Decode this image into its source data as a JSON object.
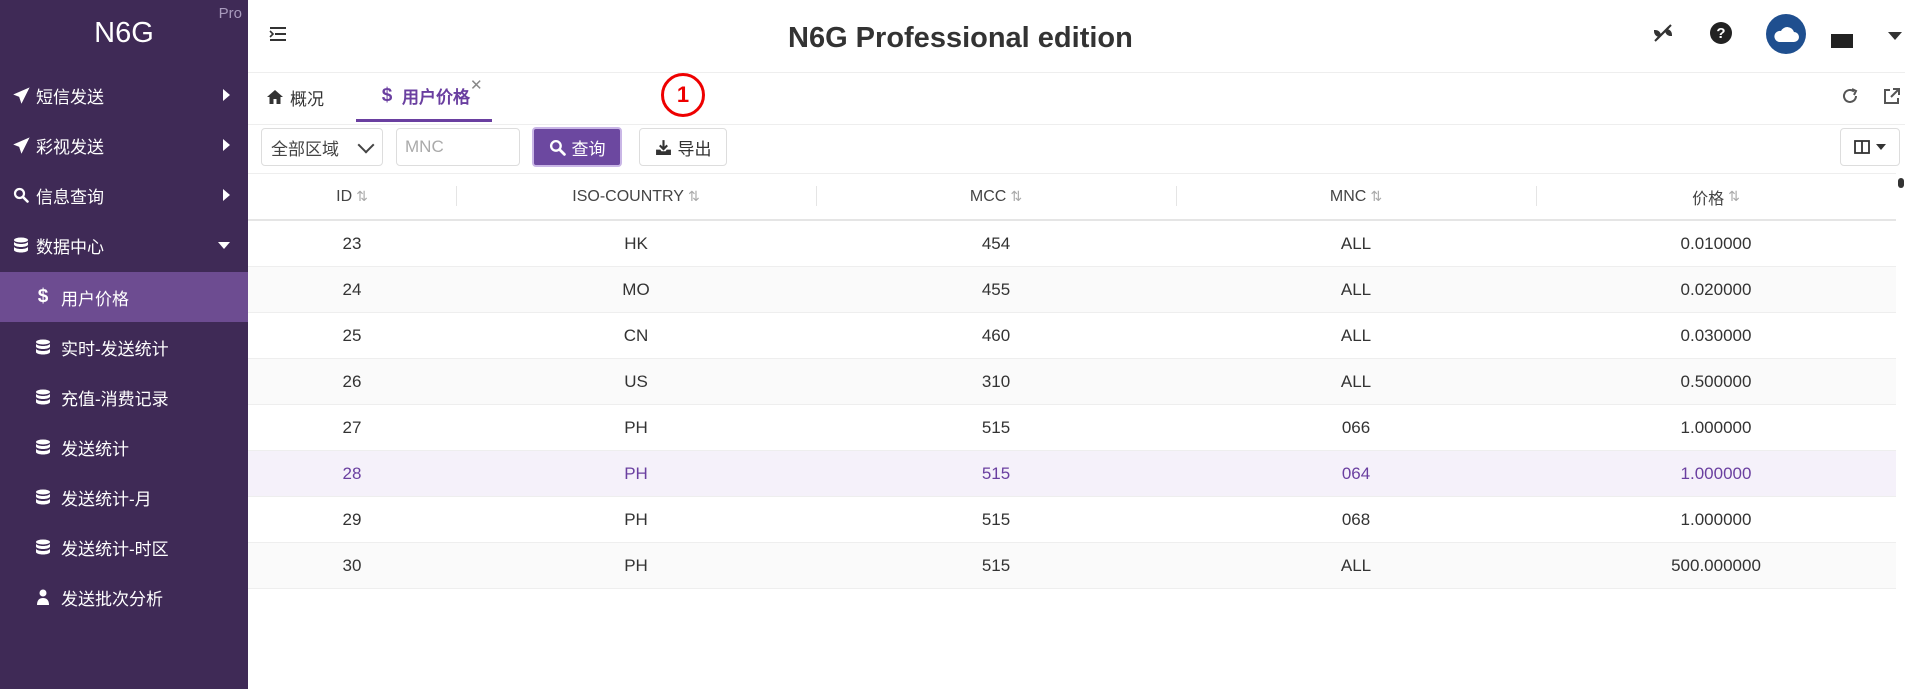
{
  "brand": {
    "name": "N6G",
    "edition_tag": "Pro"
  },
  "header": {
    "title": "N6G Professional edition"
  },
  "sidebar": {
    "items": [
      {
        "label": "短信发送",
        "icon": "paper-plane-icon",
        "expanded": false
      },
      {
        "label": "彩视发送",
        "icon": "paper-plane-icon",
        "expanded": false
      },
      {
        "label": "信息查询",
        "icon": "search-icon",
        "expanded": false
      },
      {
        "label": "数据中心",
        "icon": "database-icon",
        "expanded": true
      }
    ],
    "subitems": [
      {
        "label": "用户价格",
        "icon": "dollar-icon",
        "active": true
      },
      {
        "label": "实时-发送统计",
        "icon": "database-icon"
      },
      {
        "label": "充值-消费记录",
        "icon": "database-icon"
      },
      {
        "label": "发送统计",
        "icon": "database-icon"
      },
      {
        "label": "发送统计-月",
        "icon": "database-icon"
      },
      {
        "label": "发送统计-时区",
        "icon": "database-icon"
      },
      {
        "label": "发送批次分析",
        "icon": "user-icon"
      }
    ]
  },
  "tabs": [
    {
      "label": "概况",
      "icon": "home-icon",
      "active": false
    },
    {
      "label": "用户价格",
      "icon": "dollar-icon",
      "active": true
    }
  ],
  "annotation": {
    "badge": "1"
  },
  "toolbar": {
    "region_select": "全部区域",
    "mnc_placeholder": "MNC",
    "query_label": "查询",
    "export_label": "导出"
  },
  "table": {
    "columns": [
      "ID",
      "ISO-COUNTRY",
      "MCC",
      "MNC",
      "价格"
    ],
    "rows": [
      [
        "23",
        "HK",
        "454",
        "ALL",
        "0.010000"
      ],
      [
        "24",
        "MO",
        "455",
        "ALL",
        "0.020000"
      ],
      [
        "25",
        "CN",
        "460",
        "ALL",
        "0.030000"
      ],
      [
        "26",
        "US",
        "310",
        "ALL",
        "0.500000"
      ],
      [
        "27",
        "PH",
        "515",
        "066",
        "1.000000"
      ],
      [
        "28",
        "PH",
        "515",
        "064",
        "1.000000"
      ],
      [
        "29",
        "PH",
        "515",
        "068",
        "1.000000"
      ],
      [
        "30",
        "PH",
        "515",
        "ALL",
        "500.000000"
      ]
    ]
  },
  "colors": {
    "sidebar_bg": "#3f2a56",
    "sidebar_active": "#6d4c91",
    "accent": "#6a3fa0",
    "badge": "#e00000"
  }
}
